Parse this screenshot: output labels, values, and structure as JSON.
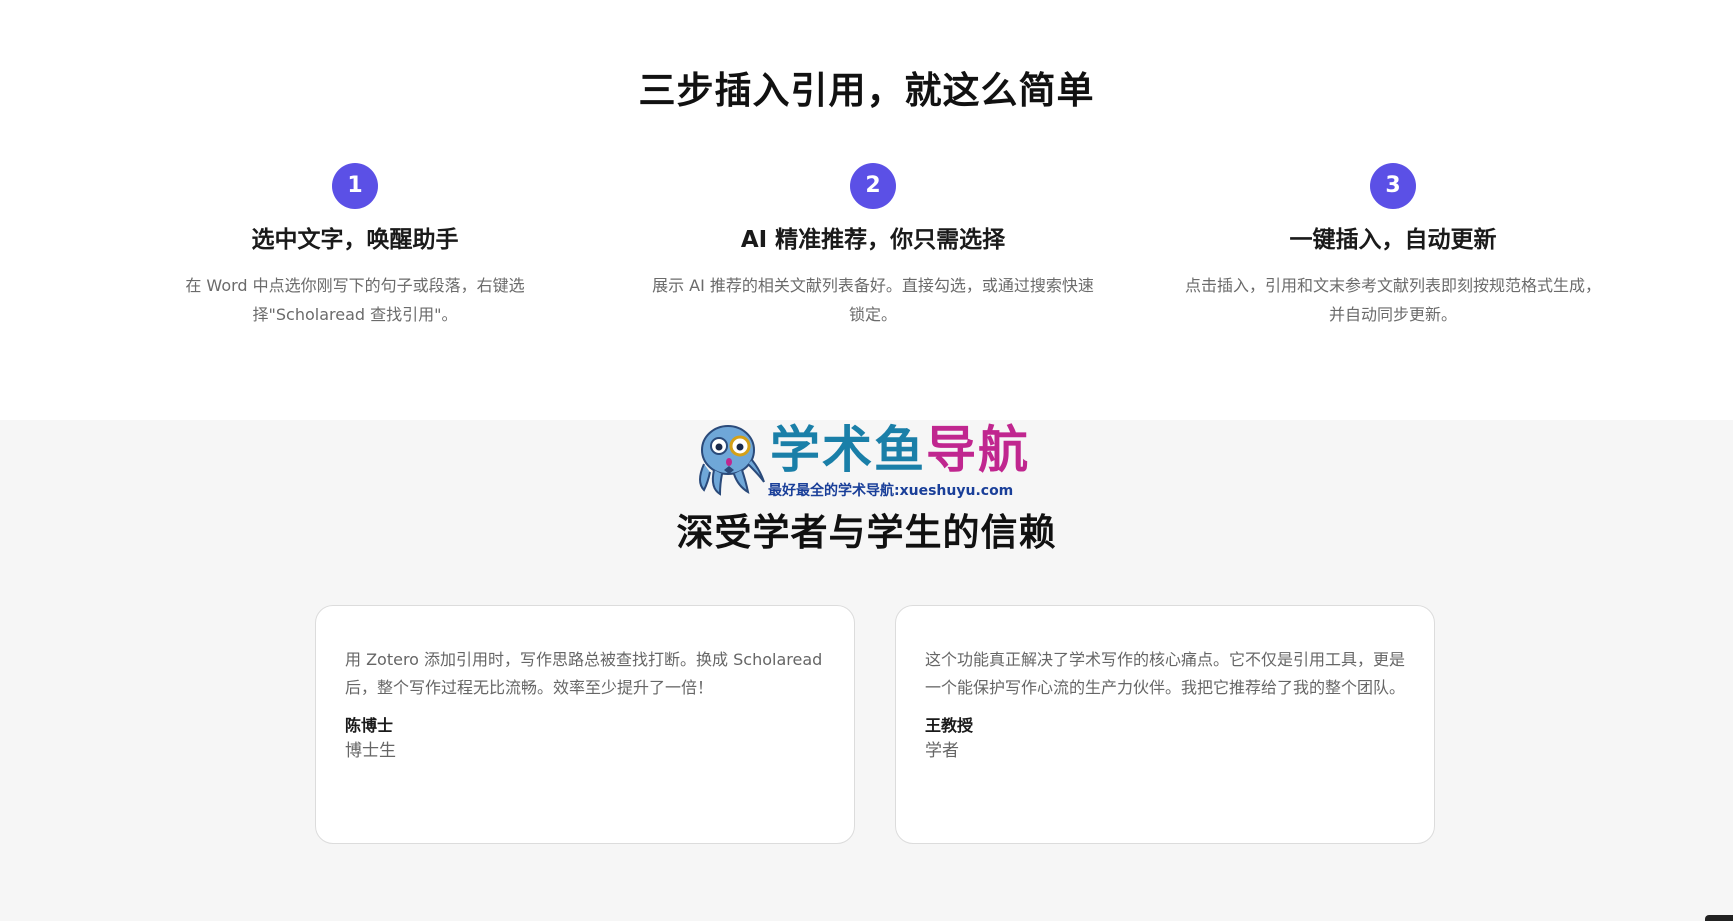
{
  "steps_section": {
    "title": "三步插入引用，就这么简单",
    "accent_color": "#5b50e6",
    "steps": [
      {
        "number": "1",
        "title": "选中文字，唤醒助手",
        "description": "在 Word 中点选你刚写下的句子或段落，右键选择\"Scholaread 查找引用\"。"
      },
      {
        "number": "2",
        "title": "AI 精准推荐，你只需选择",
        "description": "展示 AI 推荐的相关文献列表备好。直接勾选，或通过搜索快速锁定。"
      },
      {
        "number": "3",
        "title": "一键插入，自动更新",
        "description": "点击插入，引用和文末参考文献列表即刻按规范格式生成，并自动同步更新。"
      }
    ]
  },
  "watermark": {
    "name_part_a": "学术鱼",
    "name_part_b": "导航",
    "tagline": "最好最全的学术导航:xueshuyu.com",
    "icon": "octopus-mascot-icon"
  },
  "trust_section": {
    "title": "深受学者与学生的信赖",
    "testimonials": [
      {
        "quote": "用 Zotero 添加引用时，写作思路总被查找打断。换成 Scholaread 后，整个写作过程无比流畅。效率至少提升了一倍！",
        "name": "陈博士",
        "role": "博士生"
      },
      {
        "quote": "这个功能真正解决了学术写作的核心痛点。它不仅是引用工具，更是一个能保护写作心流的生产力伙伴。我把它推荐给了我的整个团队。",
        "name": "王教授",
        "role": "学者"
      }
    ]
  }
}
